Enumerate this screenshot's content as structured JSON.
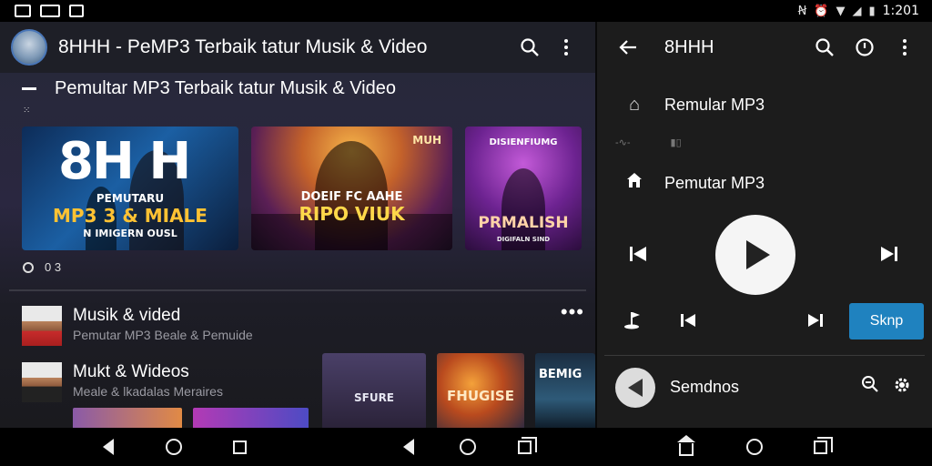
{
  "status_bar": {
    "time": "1:201",
    "left_icons": [
      "photo-icon",
      "gamepad-icon",
      "notification-icon"
    ],
    "right_icons": [
      "nfc-icon",
      "alarm-icon",
      "wifi-icon",
      "signal-icon",
      "battery-icon"
    ]
  },
  "left_app": {
    "title": "8HHH - PeMP3 Terbaik tatur Musik & Video",
    "section_title": "Pemultar MP3 Terbaik tatur Musik & Video",
    "small_mark": "⁙",
    "thumbnails": [
      {
        "big": "8H H",
        "line1": "PEMUTARU",
        "line2": "MP3 3 & MIALE",
        "line3": "N IMIGERN OUSL"
      },
      {
        "top": "MUH",
        "line1": "DOEIF FC AAHE",
        "line2": "RIPO VIUK"
      },
      {
        "top": "DISIENFIUMG",
        "line1": "PRMALISH",
        "line2": "DIGIFALN SIND"
      }
    ],
    "meta_count": "0 3",
    "list": [
      {
        "title": "Musik & vided",
        "subtitle": "Pemutar MP3 Beale & Pemuide"
      },
      {
        "title": "Mukt & Wideos",
        "subtitle": "Meale & lkadalas Meraires"
      }
    ],
    "more_label": "•••",
    "cards": [
      "SFURE",
      "FHUGISE",
      "BEMIG"
    ]
  },
  "right_app": {
    "title": "8HHH",
    "items": [
      {
        "icon": "speaker-icon",
        "label": "Remular MP3"
      },
      {
        "icon": "home-icon",
        "label": "Pemutar MP3"
      }
    ],
    "small_row": [
      "-∿-",
      "▮▯"
    ],
    "skip_label": "Sknp",
    "now_playing": "Semdnos"
  },
  "nav": {
    "buttons": [
      "back",
      "home",
      "recents",
      "back",
      "home",
      "recents",
      "home",
      "home",
      "recents"
    ]
  },
  "colors": {
    "accent": "#1f82bf",
    "panel_right": "#1c1c1c",
    "panel_left_header": "#1e1f27"
  }
}
